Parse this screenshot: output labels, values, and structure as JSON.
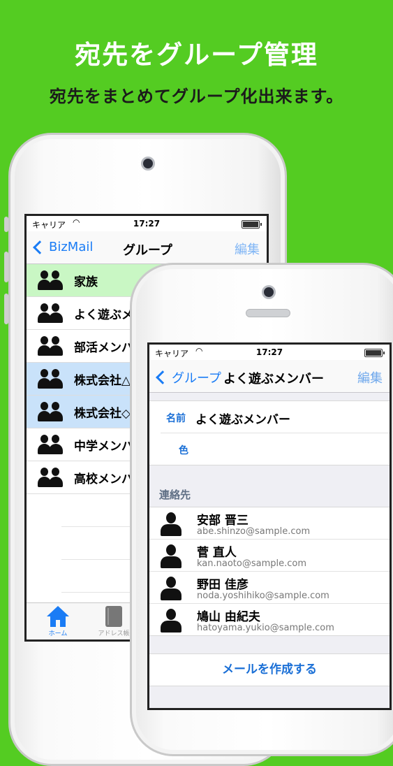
{
  "promo": {
    "headline": "宛先をグループ管理",
    "subline": "宛先をまとめてグループ化出来ます。"
  },
  "status": {
    "carrier": "キャリア",
    "time": "17:27"
  },
  "screen1": {
    "back_label": "BizMail",
    "title": "グループ",
    "edit_label": "編集",
    "groups": [
      {
        "label": "家族",
        "color": "#c9f7c4"
      },
      {
        "label": "よく遊ぶメ",
        "color": "#ffffff"
      },
      {
        "label": "部活メンバ",
        "color": "#ffffff"
      },
      {
        "label": "株式会社△",
        "color": "#c9e2fa"
      },
      {
        "label": "株式会社◇",
        "color": "#c9e2fa"
      },
      {
        "label": "中学メンバ",
        "color": "#ffffff"
      },
      {
        "label": "高校メンバ",
        "color": "#ffffff"
      }
    ],
    "tabs": [
      {
        "label": "ホーム",
        "active": true
      },
      {
        "label": "アドレス帳",
        "active": false
      }
    ]
  },
  "screen2": {
    "back_label": "グループ",
    "title": "よく遊ぶメンバー",
    "edit_label": "編集",
    "name_label": "名前",
    "name_value": "よく遊ぶメンバー",
    "color_label": "色",
    "contacts_header": "連絡先",
    "contacts": [
      {
        "name": "安部 晋三",
        "email": "abe.shinzo@sample.com"
      },
      {
        "name": "菅 直人",
        "email": "kan.naoto@sample.com"
      },
      {
        "name": "野田 佳彦",
        "email": "noda.yoshihiko@sample.com"
      },
      {
        "name": "鳩山 由紀夫",
        "email": "hatoyama.yukio@sample.com"
      }
    ],
    "compose_label": "メールを作成する"
  },
  "colors": {
    "background": "#54cc22",
    "accent": "#1a7cf5"
  }
}
